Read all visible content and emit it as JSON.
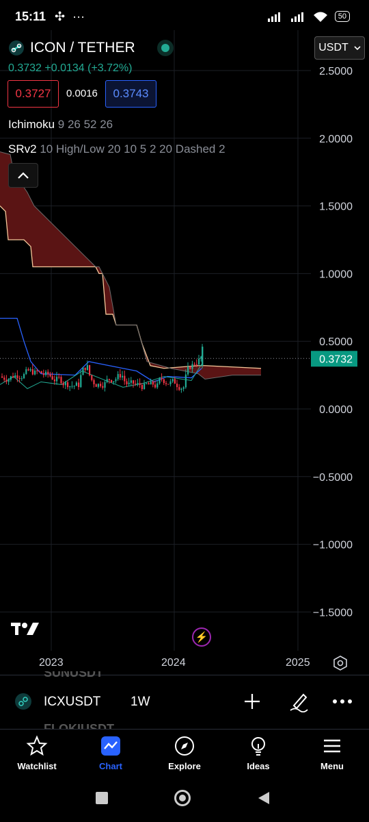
{
  "status_bar": {
    "time": "15:11",
    "left_icons": "✣ ···",
    "battery": "50"
  },
  "header": {
    "symbol_title": "ICON / TETHER",
    "currency": "USDT",
    "price_change": "0.3732 +0.0134 (+3.72%)",
    "sell_price": "0.3727",
    "spread": "0.0016",
    "buy_price": "0.3743"
  },
  "indicators": [
    {
      "name": "Ichimoku",
      "params": "9 26 52 26"
    },
    {
      "name": "SRv2",
      "params": "10 High/Low 20 10 5 2 20 Dashed 2"
    }
  ],
  "chart_data": {
    "type": "candlestick",
    "y_ticks": [
      "2.5000",
      "2.0000",
      "1.5000",
      "1.0000",
      "0.5000",
      "0.0000",
      "−0.5000",
      "−1.0000",
      "−1.5000"
    ],
    "x_ticks": [
      "2023",
      "2024",
      "2025"
    ],
    "last_price": "0.3732",
    "ylim": [
      -1.75,
      2.7
    ],
    "colors": {
      "up": "#22ab94",
      "down": "#f23645",
      "cloud_fill": "#5a1414",
      "span_a": "#f6c89a",
      "tenkan": "#2962ff",
      "kijun": "#22ab94"
    }
  },
  "symbol_bar": {
    "ticker": "ICXUSDT",
    "interval": "1W",
    "ghost_above": "SUNUSDT",
    "ghost_below": "FLOKIUSDT"
  },
  "nav": {
    "items": [
      {
        "label": "Watchlist",
        "icon": "star-icon"
      },
      {
        "label": "Chart",
        "icon": "chart-icon"
      },
      {
        "label": "Explore",
        "icon": "compass-icon"
      },
      {
        "label": "Ideas",
        "icon": "lightbulb-icon"
      },
      {
        "label": "Menu",
        "icon": "menu-icon"
      }
    ],
    "active": "Chart"
  }
}
